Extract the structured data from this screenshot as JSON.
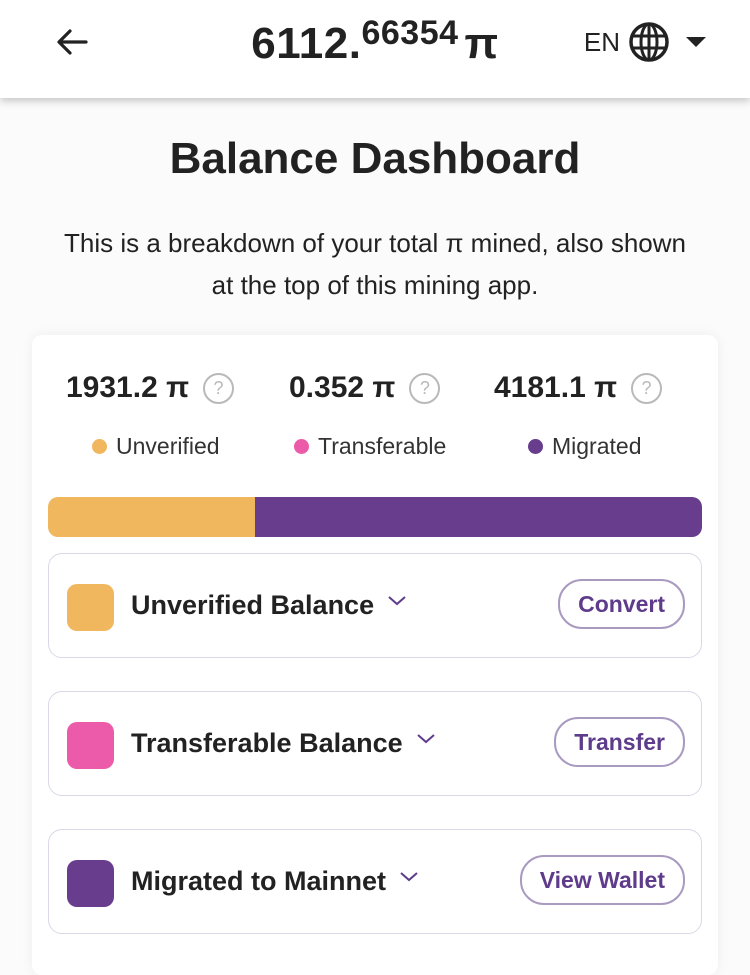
{
  "header": {
    "total_integer": "6112.",
    "total_decimal": "66354",
    "currency_symbol": "π",
    "language_code": "EN",
    "icons": {
      "back": "arrow-left-icon",
      "language": "globe-icon",
      "dropdown": "caret-down-icon"
    }
  },
  "page": {
    "title": "Balance Dashboard",
    "description": "This is a breakdown of your total π mined, also shown at the top of this mining app."
  },
  "colors": {
    "unverified": "#F0B75E",
    "transferable": "#EC5BA9",
    "migrated": "#683D8D",
    "button_text": "#5E3B8B"
  },
  "stats": [
    {
      "amount": "1931.2 π",
      "label": "Unverified",
      "color": "#F0B75E"
    },
    {
      "amount": "0.352 π",
      "label": "Transferable",
      "color": "#EC5BA9"
    },
    {
      "amount": "4181.1 π",
      "label": "Migrated",
      "color": "#683D8D"
    }
  ],
  "help_icon_glyph": "?",
  "balance_bar": {
    "values": [
      1931.2,
      0.352,
      4181.1
    ]
  },
  "rows": [
    {
      "label": "Unverified Balance",
      "button": "Convert",
      "color": "#F0B75E"
    },
    {
      "label": "Transferable Balance",
      "button": "Transfer",
      "color": "#EC5BA9"
    },
    {
      "label": "Migrated to Mainnet",
      "button": "View Wallet",
      "color": "#683D8D"
    }
  ]
}
